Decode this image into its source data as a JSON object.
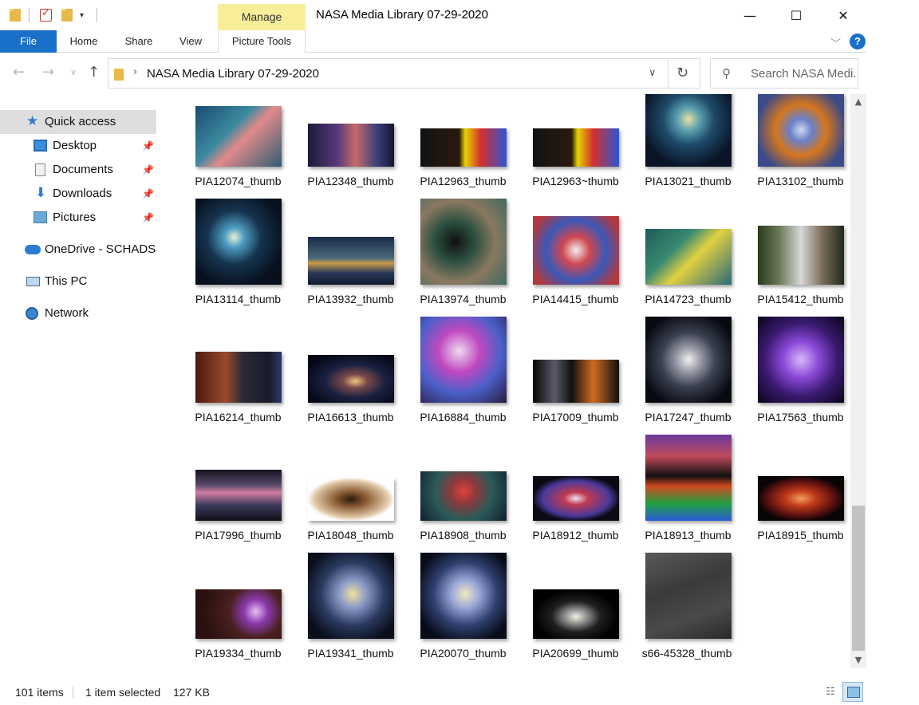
{
  "window": {
    "title": "NASA Media Library 07-29-2020",
    "contextual_tab_group": "Manage",
    "controls": {
      "minimize": "—",
      "maximize": "☐",
      "close": "✕"
    }
  },
  "ribbon": {
    "tabs": [
      "File",
      "Home",
      "Share",
      "View",
      "Picture Tools"
    ],
    "help": "?"
  },
  "address": {
    "path": "NASA Media Library 07-29-2020",
    "separator": "›",
    "search_placeholder": "Search NASA Medi..."
  },
  "navigation": {
    "items": [
      {
        "label": "Quick access",
        "icon": "star-icon",
        "selected": true
      },
      {
        "label": "Desktop",
        "icon": "desktop-icon",
        "pinned": true
      },
      {
        "label": "Documents",
        "icon": "documents-icon",
        "pinned": true
      },
      {
        "label": "Downloads",
        "icon": "download-icon",
        "pinned": true
      },
      {
        "label": "Pictures",
        "icon": "pictures-icon",
        "pinned": true
      },
      {
        "label": "OneDrive - SCHADS",
        "icon": "cloud-icon"
      },
      {
        "label": "This PC",
        "icon": "computer-icon"
      },
      {
        "label": "Network",
        "icon": "network-icon"
      }
    ]
  },
  "files": [
    {
      "name": "PIA12074_thumb",
      "bg": "linear-gradient(135deg,#1b4b6e 0%,#3d8aa0 40%,#e18a8a 55%,#2e5d73 100%)"
    },
    {
      "name": "PIA12348_thumb",
      "bg": "linear-gradient(90deg,#1c1a3a 0%,#5a3a7a 35%,#c56a6a 55%,#3a3f7a 80%,#141430 100%)"
    },
    {
      "name": "PIA12963_thumb",
      "bg": "linear-gradient(90deg,#111 0%,#2a1a10 45%,#e8d400 52%,#d32f2f 70%,#2b55d6 100%)"
    },
    {
      "name": "PIA12963~thumb",
      "bg": "linear-gradient(90deg,#111 0%,#2a1a10 45%,#e8d400 52%,#d32f2f 70%,#2b55d6 100%)"
    },
    {
      "name": "PIA13021_thumb",
      "bg": "radial-gradient(circle at 50% 45%,#e9e0a0 0%,#5aa0b0 18%,#1e4a6a 40%,#0a1426 75%)"
    },
    {
      "name": "PIA13102_thumb",
      "bg": "radial-gradient(circle at 50% 50%,#cfd8f0 0%,#6a80c8 20%,#d5761e 45%,#3a4a8a 80%)"
    },
    {
      "name": "PIA13114_thumb",
      "bg": "radial-gradient(circle at 45% 45%,#e8f0d8 0%,#4d9cc0 15%,#163450 40%,#07101c 75%)"
    },
    {
      "name": "PIA13932_thumb",
      "bg": "linear-gradient(180deg,#1a2a4a 0%,#4a6a7a 45%,#c89a4a 55%,#2a3a5a 75%,#101a2e 100%)"
    },
    {
      "name": "PIA13974_thumb",
      "bg": "radial-gradient(circle at 40% 50%,#101010 0%,#2c5040 30%,#8a7860 60%,#3e6a60 100%)"
    },
    {
      "name": "PIA14415_thumb",
      "bg": "radial-gradient(circle at 50% 50%,#f2f0f0 0%,#d04850 25%,#3a58b8 55%,#b03a40 85%)"
    },
    {
      "name": "PIA14723_thumb",
      "bg": "linear-gradient(135deg,#1e5a5a 0%,#3a8a70 35%,#e0d040 55%,#2a6a7a 100%)"
    },
    {
      "name": "PIA15412_thumb",
      "bg": "linear-gradient(90deg,#2a3a1a 0%,#6a7a5a 25%,#d8d8d8 50%,#7a6a5a 75%,#1e2a18 100%)"
    },
    {
      "name": "PIA16214_thumb",
      "bg": "linear-gradient(90deg,#4a1a10 0%,#9a4a2a 35%,#2a2a3a 55%,#1a1a2a 85%,#2a3a6a 100%)"
    },
    {
      "name": "PIA16613_thumb",
      "bg": "radial-gradient(ellipse at 55% 55%,#f0c880 0%,#7a4a4a 18%,#1a2040 45%,#060816 80%)"
    },
    {
      "name": "PIA16884_thumb",
      "bg": "radial-gradient(circle at 45% 40%,#f0d8f0 0%,#c048c0 30%,#4a60c8 60%,#2a1a40 100%)"
    },
    {
      "name": "PIA17009_thumb",
      "bg": "linear-gradient(90deg,#050505 0%,#5a5a6a 25%,#101010 45%,#d06a20 70%,#101010 100%)"
    },
    {
      "name": "PIA17247_thumb",
      "bg": "radial-gradient(circle at 50% 50%,#f0f0f0 0%,#9a9aa8 20%,#3a4050 45%,#080a12 80%)"
    },
    {
      "name": "PIA17563_thumb",
      "bg": "radial-gradient(circle at 50% 50%,#d8b8f8 0%,#8a48d8 30%,#3a1a70 60%,#0a0418 100%)"
    },
    {
      "name": "PIA17996_thumb",
      "bg": "linear-gradient(180deg,#15121e 0%,#5a4a6a 30%,#d07aa0 45%,#3a3a5a 70%,#120f18 100%)"
    },
    {
      "name": "PIA18048_thumb",
      "bg": "radial-gradient(ellipse at 50% 50%,#2a1a10 0%,#8a5a30 25%,#e0c8a8 60%,#ffffff 72%)"
    },
    {
      "name": "PIA18908_thumb",
      "bg": "radial-gradient(circle at 50% 40%,#e04040 0%,#8a3a3a 25%,#2a5a5a 55%,#10202a 100%)"
    },
    {
      "name": "PIA18912_thumb",
      "bg": "radial-gradient(ellipse at 50% 50%,#f0e0f0 0%,#c03a50 20%,#4a3a9a 55%,#0a0a14 72%)"
    },
    {
      "name": "PIA18913_thumb",
      "bg": "linear-gradient(180deg,#6a3aa0 0%,#c04a5a 25%,#101010 48%,#d04a20 60%,#20a040 80%,#2a5ad8 100%)"
    },
    {
      "name": "PIA18915_thumb",
      "bg": "radial-gradient(ellipse at 50% 50%,#f0a060 0%,#c03a1a 25%,#5a1010 55%,#0a0505 72%)"
    },
    {
      "name": "PIA19334_thumb",
      "bg": "radial-gradient(circle at 70% 45%,#e8c0f0 0%,#8a3ab0 18%,#4a2020 40%,#2a1010 80%)"
    },
    {
      "name": "PIA19341_thumb",
      "bg": "radial-gradient(circle at 52% 48%,#f0e0a0 0%,#8a9ac8 22%,#2a3a60 50%,#0a0e1a 80%)"
    },
    {
      "name": "PIA20070_thumb",
      "bg": "radial-gradient(circle at 52% 48%,#f0e8c0 0%,#9aa8d8 22%,#304070 50%,#080c18 80%)"
    },
    {
      "name": "PIA20699_thumb",
      "bg": "radial-gradient(ellipse at 50% 55%,#f8f0e0 0%,#a0a0a0 15%,#202020 40%,#000 70%)"
    },
    {
      "name": "s66-45328_thumb",
      "bg": "linear-gradient(160deg,#5a5a5a 0%,#3a3a3a 40%,#4a4a4a 70%,#2a2a2a 100%)"
    }
  ],
  "status": {
    "item_count": "101 items",
    "selection": "1 item selected",
    "size": "127 KB"
  }
}
